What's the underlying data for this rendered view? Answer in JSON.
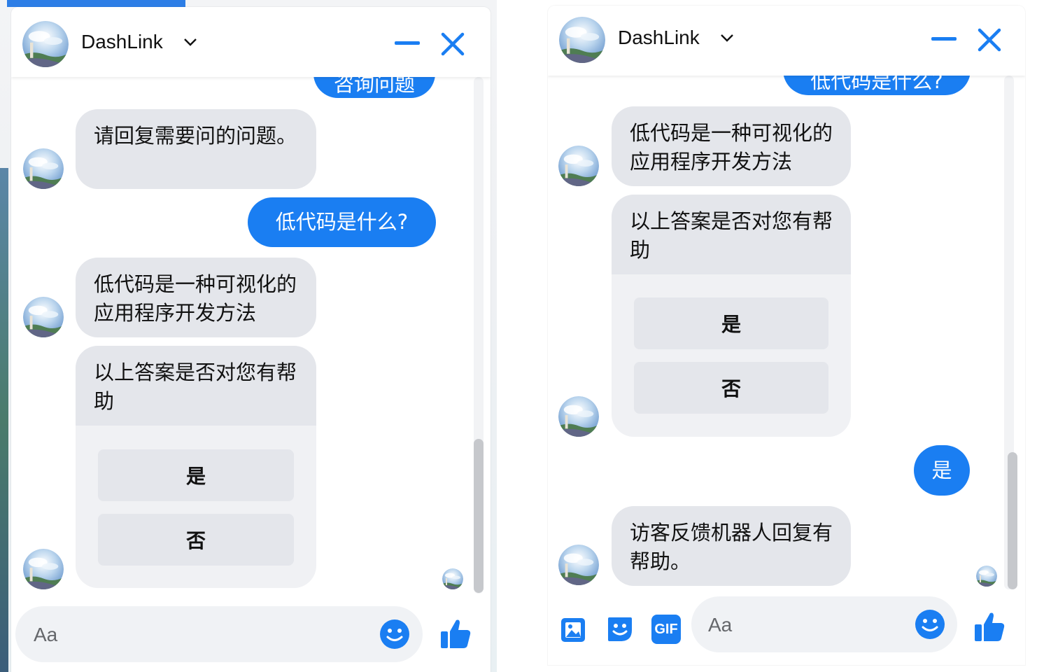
{
  "colors": {
    "accent": "#1a7ef2",
    "bot_bubble": "#e4e6eb",
    "card_bg": "#f0f1f4"
  },
  "left": {
    "header": {
      "title": "DashLink"
    },
    "messages": {
      "user_partial": "咨询问题",
      "bot_1": "请回复需要问的问题。",
      "user_1": "低代码是什么?",
      "bot_2": "低代码是一种可视化的应用程序开发方法",
      "card_question": "以上答案是否对您有帮助",
      "opt_yes": "是",
      "opt_no": "否"
    },
    "composer": {
      "placeholder": "Aa"
    }
  },
  "right": {
    "header": {
      "title": "DashLink"
    },
    "messages": {
      "user_partial": "低代码是什么?",
      "bot_1": "低代码是一种可视化的应用程序开发方法",
      "card_question": "以上答案是否对您有帮助",
      "opt_yes": "是",
      "opt_no": "否",
      "user_1": "是",
      "bot_2": "访客反馈机器人回复有帮助。"
    },
    "composer": {
      "placeholder": "Aa",
      "gif_label": "GIF"
    }
  },
  "icons": [
    "avatar",
    "chevron-down-icon",
    "minimize-icon",
    "close-icon",
    "image-icon",
    "sticker-icon",
    "gif-icon",
    "emoji-icon",
    "thumbs-up-icon"
  ]
}
